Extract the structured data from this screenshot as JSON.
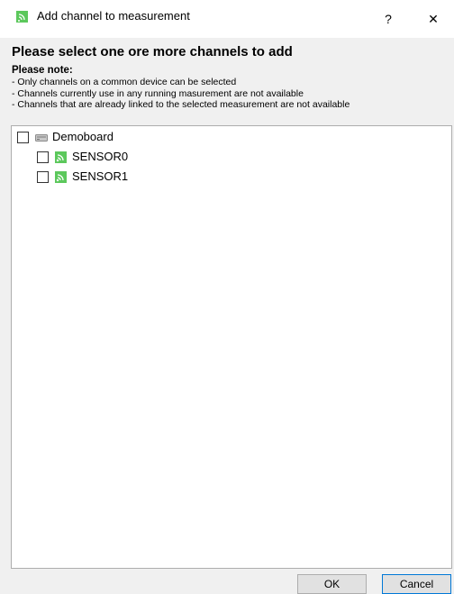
{
  "window": {
    "title": "Add channel to measurement",
    "help_label": "?",
    "close_label": "✕",
    "icon": "sensor-signal-icon",
    "accent_color": "#5cc85c"
  },
  "header": {
    "title": "Please select one ore more channels to add",
    "note_title": "Please note:",
    "notes": [
      "- Only channels on a common device can be selected",
      "- Channels currently use in any running masurement are not available",
      "- Channels that are already linked to the selected measurement are not available"
    ]
  },
  "tree": {
    "device": {
      "label": "Demoboard",
      "icon": "device-board-icon",
      "checked": false
    },
    "channels": [
      {
        "label": "SENSOR0",
        "icon": "sensor-signal-icon",
        "checked": false
      },
      {
        "label": "SENSOR1",
        "icon": "sensor-signal-icon",
        "checked": false
      }
    ]
  },
  "buttons": {
    "ok_label": "OK",
    "cancel_label": "Cancel"
  }
}
